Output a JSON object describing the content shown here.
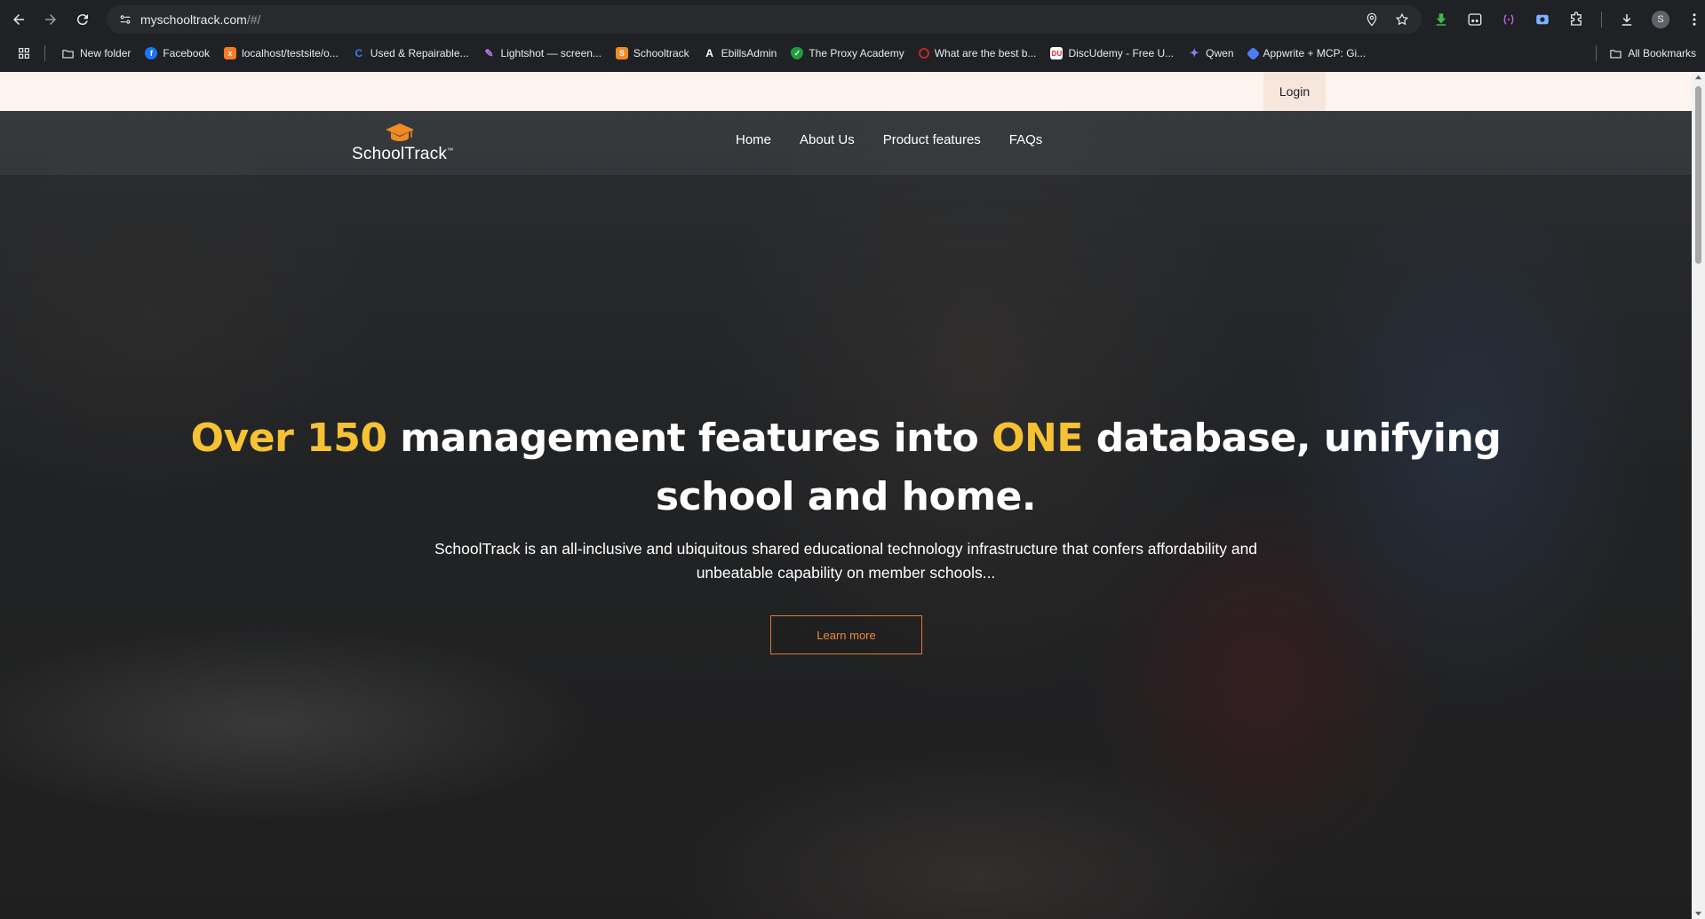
{
  "browser": {
    "url_host": "myschooltrack.com",
    "url_path": "/#/",
    "profile_initial": "S",
    "bookmarks": [
      {
        "label": "New folder",
        "icon": "folder-icon"
      },
      {
        "label": "Facebook",
        "icon": "facebook-icon",
        "color": "#1877f2"
      },
      {
        "label": "localhost/testsite/o...",
        "icon": "xampp-icon",
        "color": "#fb7a24"
      },
      {
        "label": "Used & Repairable...",
        "icon": "copart-icon",
        "color": "#1a5cd6"
      },
      {
        "label": "Lightshot — screen...",
        "icon": "feather-icon",
        "color": "#b07cf0"
      },
      {
        "label": "Schooltrack",
        "icon": "schooltrack-icon",
        "color": "#f08a24"
      },
      {
        "label": "EbillsAdmin",
        "icon": "ebills-icon",
        "color": "#ffffff"
      },
      {
        "label": "The Proxy Academy",
        "icon": "shield-icon",
        "color": "#1f9d3a"
      },
      {
        "label": "What are the best b...",
        "icon": "quora-icon",
        "color": "#b92b27"
      },
      {
        "label": "DiscUdemy - Free U...",
        "icon": "discudemy-icon",
        "color": "#d32f2f"
      },
      {
        "label": "Qwen",
        "icon": "qwen-icon",
        "color": "#8b7cf6"
      },
      {
        "label": "Appwrite + MCP: Gi...",
        "icon": "appwrite-icon",
        "color": "#4f7cf6"
      }
    ],
    "all_bookmarks_label": "All Bookmarks"
  },
  "site": {
    "login_label": "Login",
    "logo_text": "SchoolTrack",
    "logo_tm": "™",
    "nav": [
      "Home",
      "About Us",
      "Product features",
      "FAQs"
    ],
    "headline": {
      "part1": "Over 150",
      "part2": " management features into ",
      "part3": "ONE",
      "part4": " database, unifying school and home."
    },
    "subtext": "SchoolTrack is an all-inclusive and ubiquitous shared educational technology infrastructure that confers affordability and unbeatable capability on member schools...",
    "cta_label": "Learn more",
    "colors": {
      "accent_yellow": "#f6c234",
      "cta_orange": "#e07a2e",
      "topbar_bg": "#fdf4ef"
    }
  }
}
